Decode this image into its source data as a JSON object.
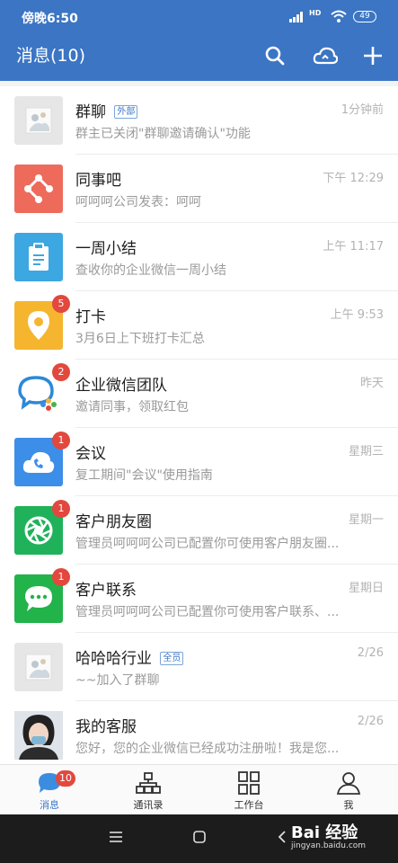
{
  "status_bar": {
    "time": "傍晚6:50",
    "network": "HD",
    "battery": "49"
  },
  "header": {
    "title": "消息(10)",
    "search_icon": "search-icon",
    "cloud_icon": "cloud-icon",
    "add_icon": "plus-icon"
  },
  "conversations": [
    {
      "name": "群聊",
      "tag": "外部",
      "time": "1分钟前",
      "preview": "群主已关闭\"群聊邀请确认\"功能",
      "badge": "",
      "icon": "group-avatar-icon",
      "color": "#e6e6e6"
    },
    {
      "name": "同事吧",
      "tag": "",
      "time": "下午 12:29",
      "preview": "呵呵呵公司发表：呵呵",
      "badge": "",
      "icon": "colleague-icon",
      "color": "#ee6b5b"
    },
    {
      "name": "一周小结",
      "tag": "",
      "time": "上午 11:17",
      "preview": "查收你的企业微信一周小结",
      "badge": "",
      "icon": "clipboard-icon",
      "color": "#3ca7e0"
    },
    {
      "name": "打卡",
      "tag": "",
      "time": "上午 9:53",
      "preview": "3月6日上下班打卡汇总",
      "badge": "5",
      "icon": "location-pin-icon",
      "color": "#f5b52e"
    },
    {
      "name": "企业微信团队",
      "tag": "",
      "time": "昨天",
      "preview": "邀请同事，领取红包",
      "badge": "2",
      "icon": "wework-logo-icon",
      "color": "#ffffff"
    },
    {
      "name": "会议",
      "tag": "",
      "time": "星期三",
      "preview": "复工期间\"会议\"使用指南",
      "badge": "1",
      "icon": "cloud-phone-icon",
      "color": "#3d8ee8"
    },
    {
      "name": "客户朋友圈",
      "tag": "",
      "time": "星期一",
      "preview": "管理员呵呵呵公司已配置你可使用客户朋友圈...",
      "badge": "1",
      "icon": "aperture-icon",
      "color": "#1fb25a"
    },
    {
      "name": "客户联系",
      "tag": "",
      "time": "星期日",
      "preview": "管理员呵呵呵公司已配置你可使用客户联系、...",
      "badge": "1",
      "icon": "chat-bubble-icon",
      "color": "#22b34a"
    },
    {
      "name": "哈哈哈行业",
      "tag": "全员",
      "time": "2/26",
      "preview": "~~加入了群聊",
      "badge": "",
      "icon": "group-avatar-icon",
      "color": "#e6e6e6"
    },
    {
      "name": "我的客服",
      "tag": "",
      "time": "2/26",
      "preview": "您好，您的企业微信已经成功注册啦！我是您...",
      "badge": "",
      "icon": "user-photo-icon",
      "color": "#d9dde2"
    }
  ],
  "tabs": [
    {
      "label": "消息",
      "badge": "10",
      "icon": "message-icon"
    },
    {
      "label": "通讯录",
      "badge": "",
      "icon": "contacts-icon"
    },
    {
      "label": "工作台",
      "badge": "",
      "icon": "workbench-icon"
    },
    {
      "label": "我",
      "badge": "",
      "icon": "profile-icon"
    }
  ],
  "watermark": {
    "line1": "Bai 经验",
    "line2": "jingyan.baidu.com"
  }
}
